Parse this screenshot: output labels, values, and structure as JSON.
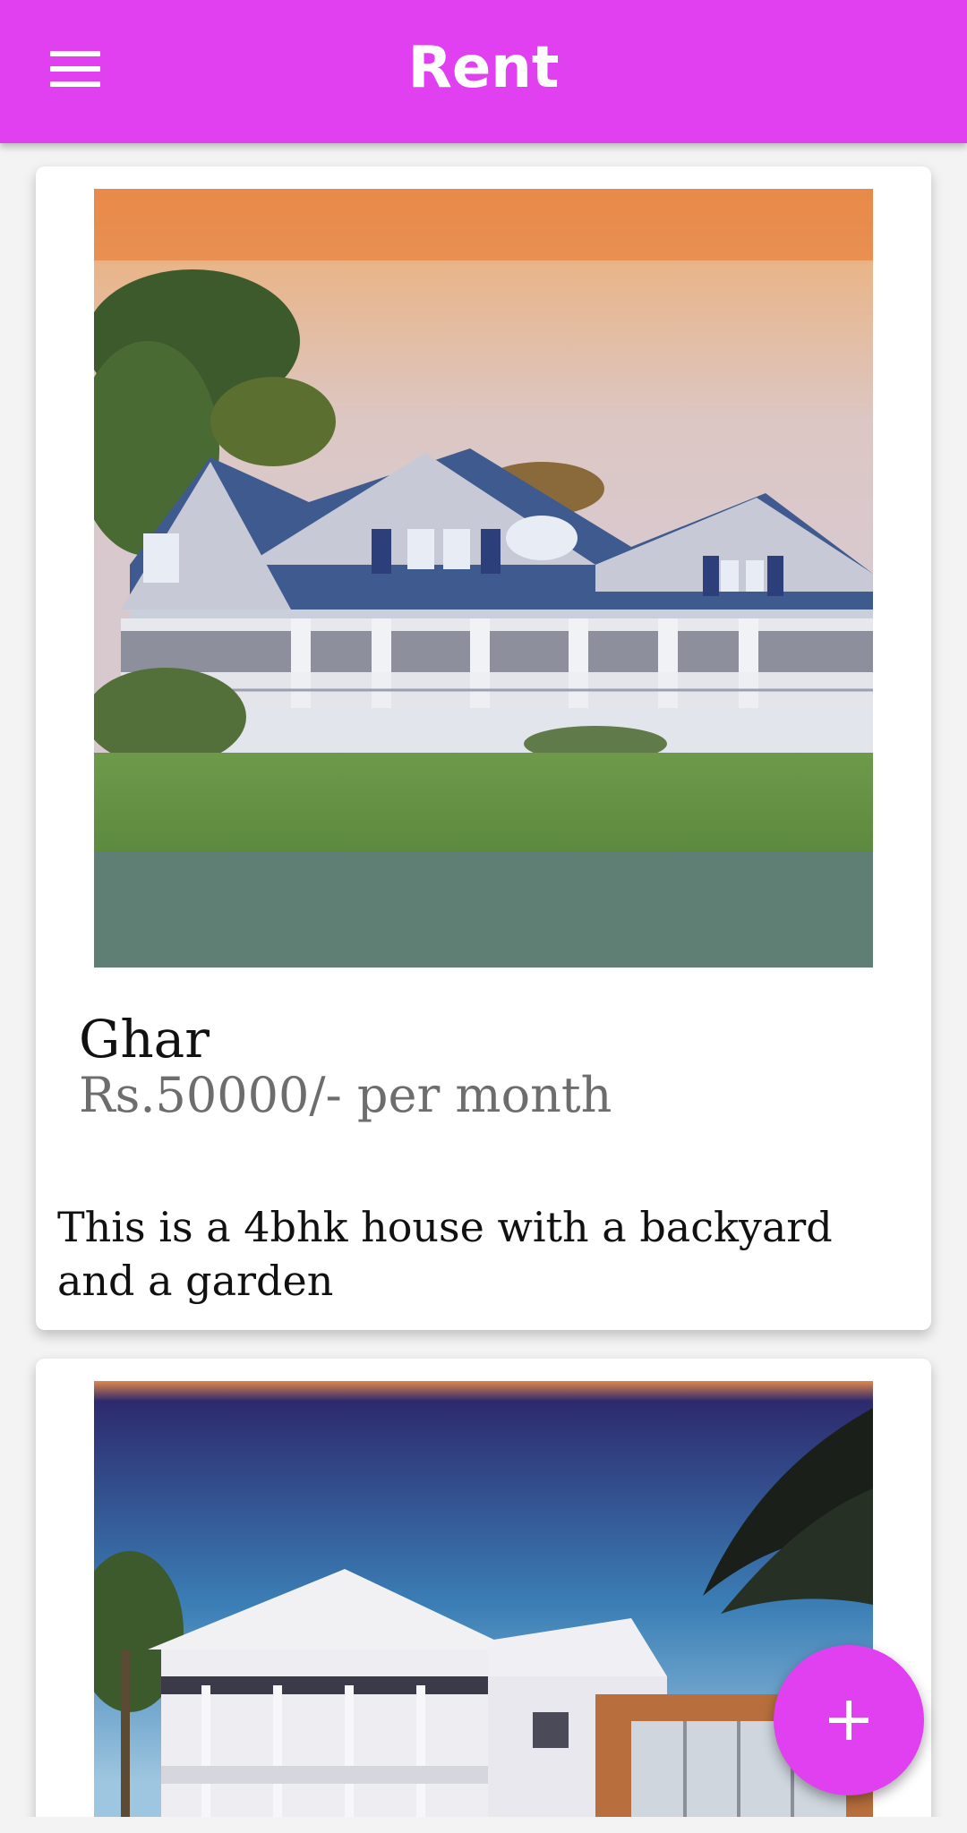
{
  "app_bar": {
    "title": "Rent",
    "menu_icon": "hamburger-menu-icon",
    "color": "#e040f0"
  },
  "listings": [
    {
      "title": "Ghar",
      "price": "Rs.50000/- per month",
      "description": "This is a 4bhk house with a backyard and a garden",
      "photo": "two-story white house with blue roof and wrap-around porch"
    },
    {
      "photo": "white two-story house with balcony and palm trees"
    }
  ],
  "fab": {
    "icon": "plus-icon",
    "color": "#e040f0"
  }
}
